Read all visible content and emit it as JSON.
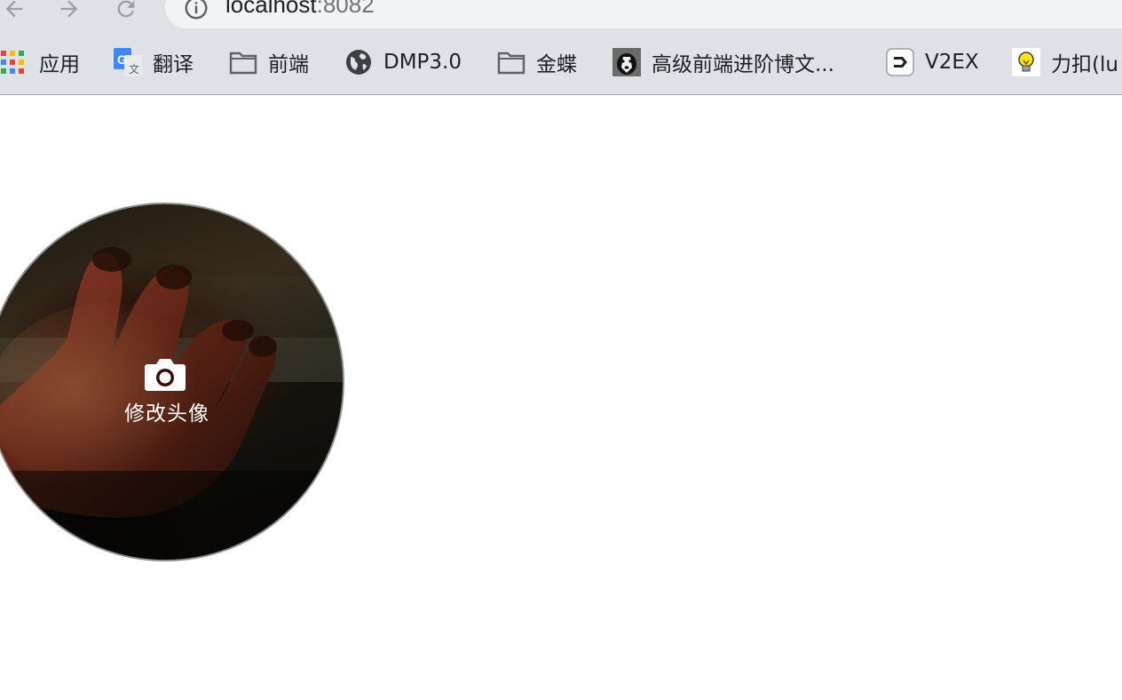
{
  "browser": {
    "url_host": "localhost",
    "url_port": ":8082",
    "nav_icons": [
      "back-arrow-icon",
      "forward-arrow-icon",
      "reload-icon",
      "info-icon"
    ]
  },
  "bookmarks": [
    {
      "label": "应用",
      "icon": "apps-grid-icon"
    },
    {
      "label": "翻译",
      "icon": "google-translate-icon"
    },
    {
      "label": "前端",
      "icon": "folder-icon"
    },
    {
      "label": "DMP3.0",
      "icon": "globe-icon"
    },
    {
      "label": "金蝶",
      "icon": "folder-icon"
    },
    {
      "label": "高级前端进阶博文...",
      "icon": "dog-avatar-icon"
    },
    {
      "label": "V2EX",
      "icon": "v2ex-icon"
    },
    {
      "label": "力扣(lu",
      "icon": "lightbulb-icon"
    }
  ],
  "avatar": {
    "caption": "修改头像",
    "icon": "camera-icon"
  },
  "colors": {
    "chrome_bg": "#dee1e6",
    "omnibox_bg": "#f1f3f4",
    "text": "#202124",
    "muted": "#70757a"
  }
}
